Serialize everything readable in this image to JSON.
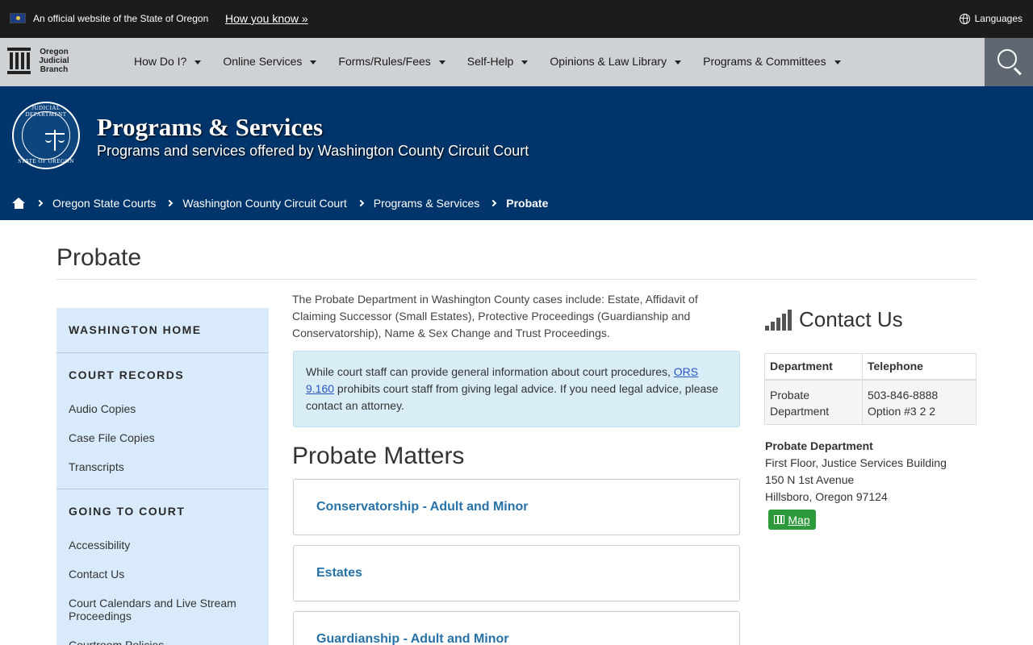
{
  "official_bar": {
    "text": "An official website of the State of Oregon",
    "how_link": "How you know »",
    "languages": "Languages"
  },
  "nav": {
    "logo_lines": [
      "Oregon",
      "Judicial",
      "Branch"
    ],
    "items": [
      {
        "label": "How Do I?"
      },
      {
        "label": "Online Services"
      },
      {
        "label": "Forms/Rules/Fees"
      },
      {
        "label": "Self-Help"
      },
      {
        "label": "Opinions & Law Library"
      },
      {
        "label": "Programs & Committees"
      }
    ]
  },
  "banner": {
    "seal_top": "JUDICIAL DEPARTMENT",
    "seal_bottom": "STATE OF OREGON",
    "title": "Programs & Services",
    "subtitle": "Programs and services offered by Washington County Circuit Court"
  },
  "breadcrumb": {
    "items": [
      {
        "label": "Oregon State Courts"
      },
      {
        "label": "Washington County Circuit Court"
      },
      {
        "label": "Programs & Services"
      },
      {
        "label": "Probate"
      }
    ]
  },
  "page": {
    "title": "Probate"
  },
  "sidebar": {
    "home": "WASHINGTON HOME",
    "sections": [
      {
        "heading": "COURT RECORDS",
        "links": [
          "Audio Copies",
          "Case File Copies",
          "Transcripts"
        ]
      },
      {
        "heading": "GOING TO COURT",
        "links": [
          "Accessibility",
          "Contact Us",
          "Court Calendars and Live Stream Proceedings",
          "Courtroom Policies"
        ]
      }
    ]
  },
  "main": {
    "intro": "The Probate Department in Washington County cases include: Estate, Affidavit of Claiming Successor (Small Estates), Protective Proceedings (Guardianship and Conservatorship), Name & Sex Change and Trust Proceedings.",
    "alert": {
      "before": "While court staff can provide general information about court procedures, ",
      "link": "ORS 9.160",
      "after": " prohibits court staff from giving legal advice. If you need legal advice, please contact an attorney."
    },
    "section_title": "Probate Matters",
    "accordions": [
      {
        "label": "Conservatorship - Adult and Minor"
      },
      {
        "label": "Estates"
      },
      {
        "label": "Guardianship - Adult and Minor"
      }
    ]
  },
  "contact": {
    "title": "Contact Us",
    "headers": [
      "Department",
      "Telephone"
    ],
    "rows": [
      {
        "dept_lines": [
          "Probate",
          "Department"
        ],
        "phone_lines": [
          "503-846-8888",
          "Option #3 2 2"
        ]
      }
    ],
    "address": {
      "name": "Probate Department",
      "line1": "First Floor, Justice Services Building",
      "line2": "150 N 1st Avenue",
      "line3": "Hillsboro, Oregon 97124"
    },
    "map_label": "Map"
  },
  "colors": {
    "banner_blue": "#00356b",
    "sidebar_bg": "#d9ebfb",
    "link_blue": "#2672a8",
    "map_green": "#2c9a3a"
  }
}
